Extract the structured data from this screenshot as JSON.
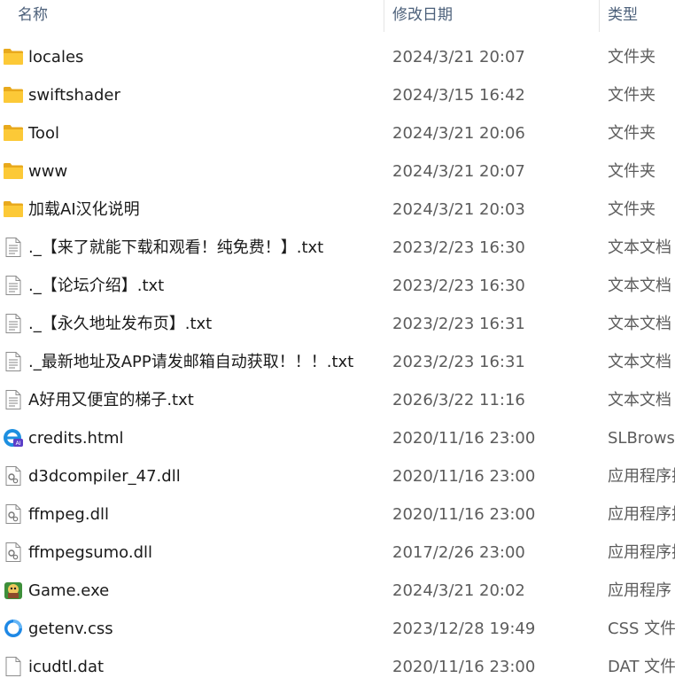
{
  "columns": {
    "name": "名称",
    "date": "修改日期",
    "type": "类型"
  },
  "files": [
    {
      "name": "locales",
      "date": "2024/3/21 20:07",
      "type": "文件夹",
      "icon": "folder-icon"
    },
    {
      "name": "swiftshader",
      "date": "2024/3/15 16:42",
      "type": "文件夹",
      "icon": "folder-icon"
    },
    {
      "name": "Tool",
      "date": "2024/3/21 20:06",
      "type": "文件夹",
      "icon": "folder-icon"
    },
    {
      "name": "www",
      "date": "2024/3/21 20:07",
      "type": "文件夹",
      "icon": "folder-icon"
    },
    {
      "name": "加载AI汉化说明",
      "date": "2024/3/21 20:03",
      "type": "文件夹",
      "icon": "folder-icon"
    },
    {
      "name": "._【来了就能下载和观看！纯免费！】.txt",
      "date": "2023/2/23 16:30",
      "type": "文本文档",
      "icon": "text-file-icon"
    },
    {
      "name": "._【论坛介绍】.txt",
      "date": "2023/2/23 16:30",
      "type": "文本文档",
      "icon": "text-file-icon"
    },
    {
      "name": "._【永久地址发布页】.txt",
      "date": "2023/2/23 16:31",
      "type": "文本文档",
      "icon": "text-file-icon"
    },
    {
      "name": "._最新地址及APP请发邮箱自动获取！！！.txt",
      "date": "2023/2/23 16:31",
      "type": "文本文档",
      "icon": "text-file-icon"
    },
    {
      "name": "A好用又便宜的梯子.txt",
      "date": "2026/3/22 11:16",
      "type": "文本文档",
      "icon": "text-file-icon"
    },
    {
      "name": "credits.html",
      "date": "2020/11/16 23:00",
      "type": "SLBrowser",
      "icon": "browser-icon"
    },
    {
      "name": "d3dcompiler_47.dll",
      "date": "2020/11/16 23:00",
      "type": "应用程序扩展",
      "icon": "dll-file-icon"
    },
    {
      "name": "ffmpeg.dll",
      "date": "2020/11/16 23:00",
      "type": "应用程序扩展",
      "icon": "dll-file-icon"
    },
    {
      "name": "ffmpegsumo.dll",
      "date": "2017/2/26 23:00",
      "type": "应用程序扩展",
      "icon": "dll-file-icon"
    },
    {
      "name": "Game.exe",
      "date": "2024/3/21 20:02",
      "type": "应用程序",
      "icon": "game-exe-icon"
    },
    {
      "name": "getenv.css",
      "date": "2023/12/28 19:49",
      "type": "CSS 文件",
      "icon": "css-file-icon"
    },
    {
      "name": "icudtl.dat",
      "date": "2020/11/16 23:00",
      "type": "DAT 文件",
      "icon": "blank-file-icon"
    }
  ]
}
